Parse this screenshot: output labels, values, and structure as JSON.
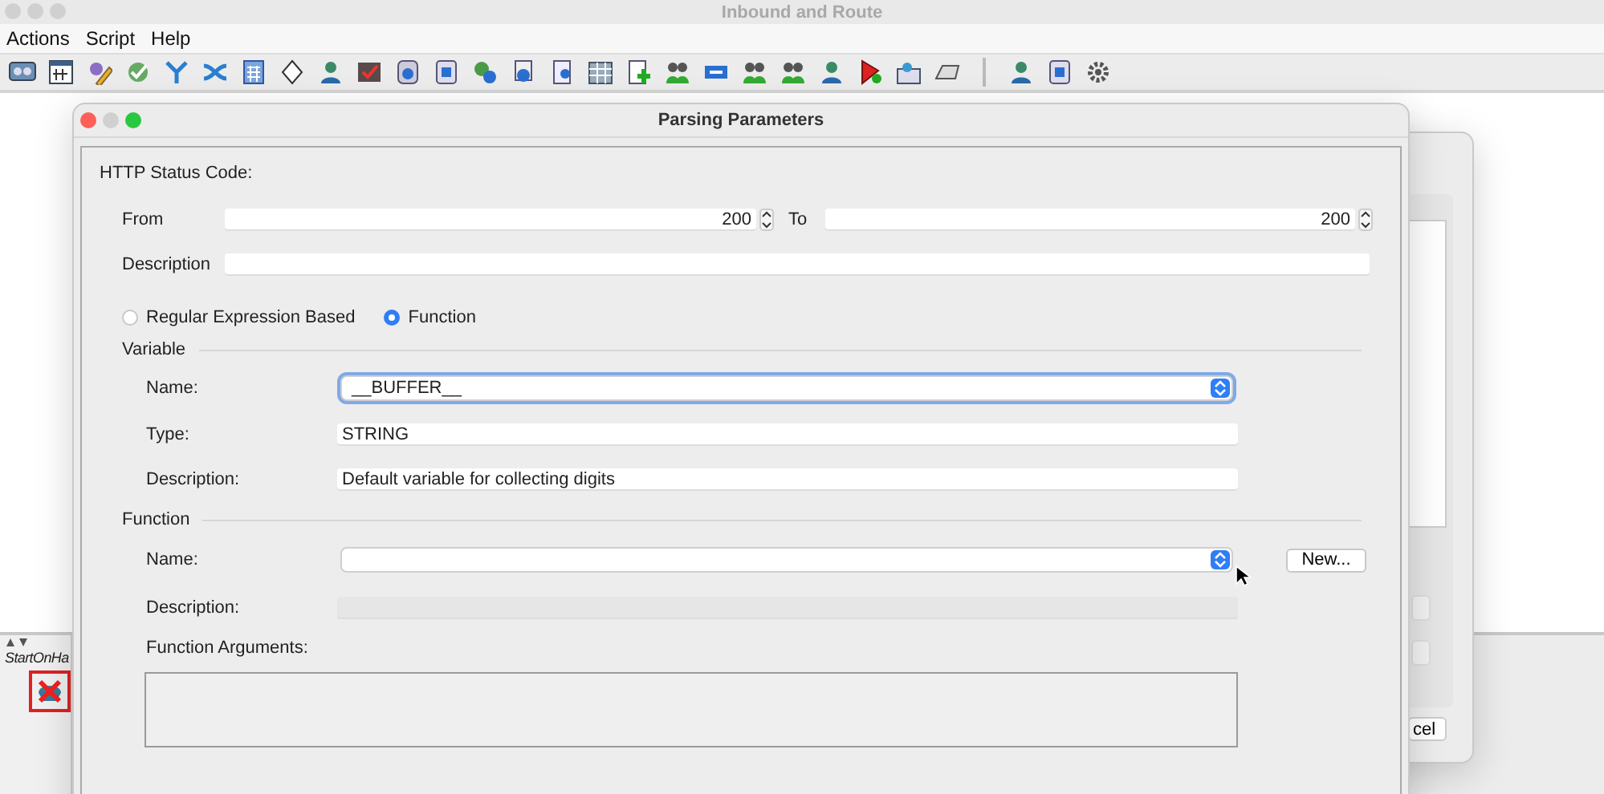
{
  "app_window": {
    "title": "Inbound and Route"
  },
  "menu": [
    "Actions",
    "Script",
    "Help"
  ],
  "canvas": {
    "node": {
      "label": "StartOnHa"
    }
  },
  "back_dialog": {
    "button": "cel"
  },
  "dialog": {
    "title": "Parsing Parameters",
    "status_code": {
      "heading": "HTTP Status Code:",
      "from_label": "From",
      "from_value": "200",
      "to_label": "To",
      "to_value": "200",
      "description_label": "Description"
    },
    "parse_modes": [
      {
        "label": "Regular Expression Based",
        "selected": false
      },
      {
        "label": "Function",
        "selected": true
      }
    ],
    "variable": {
      "heading": "Variable",
      "name_label": "Name:",
      "name_value": "__BUFFER__",
      "focused": true,
      "type_label": "Type:",
      "type_value": "STRING",
      "description_label": "Description:",
      "description_value": "Default variable for collecting digits"
    },
    "function": {
      "heading": "Function",
      "name_label": "Name:",
      "new_button": "New...",
      "description_label": "Description:",
      "arguments_label": "Function Arguments:"
    }
  }
}
